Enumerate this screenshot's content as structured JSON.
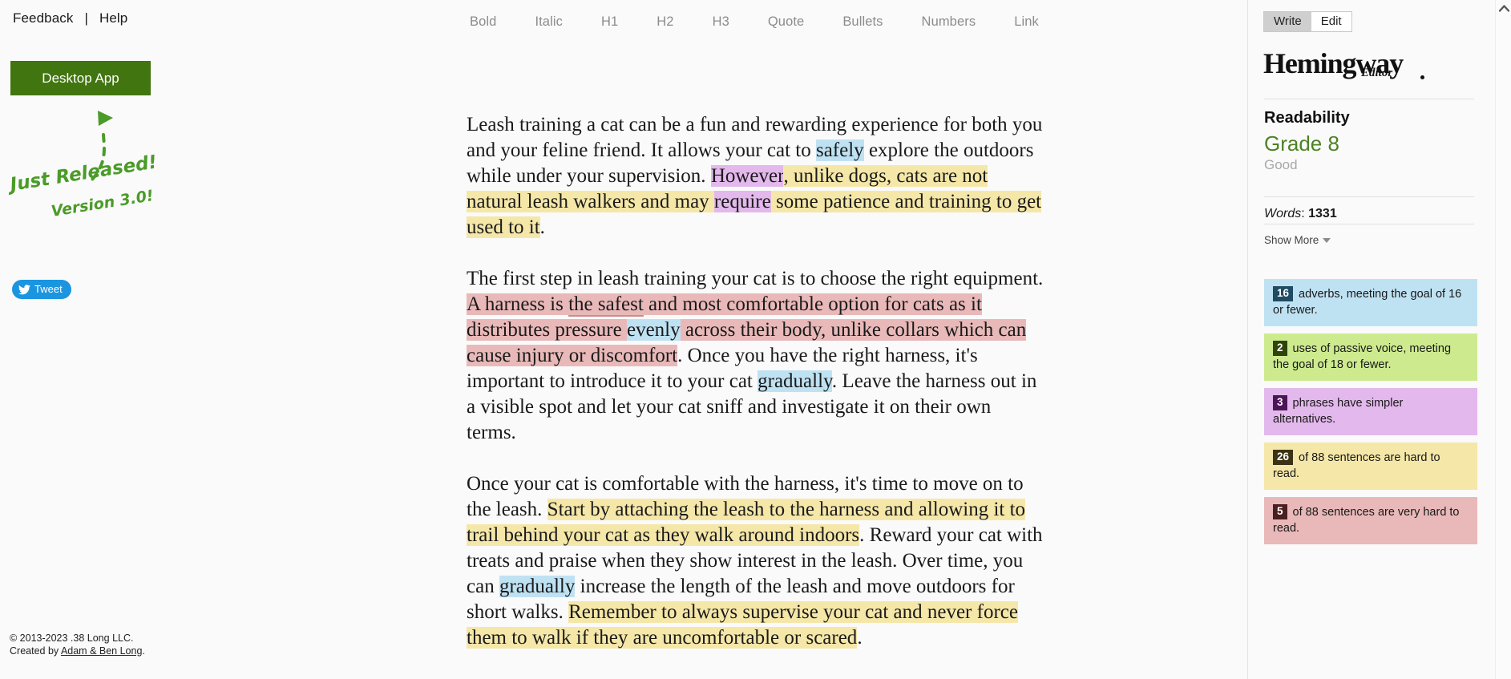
{
  "left": {
    "nav": {
      "feedback": "Feedback",
      "separator": "|",
      "help": "Help"
    },
    "desktop_app_button": "Desktop App",
    "promo": {
      "line1": "Just Released!",
      "line2": "Version 3.0!",
      "color": "#4b9b29"
    },
    "tweet_button": "Tweet",
    "footer": {
      "copyright": "© 2013-2023 .38 Long LLC.",
      "created_by_prefix": "Created by ",
      "created_by_link": "Adam & Ben Long",
      "created_by_suffix": "."
    }
  },
  "toolbar": {
    "items": [
      {
        "label": "Bold",
        "icon": "bold-icon"
      },
      {
        "label": "Italic",
        "icon": "italic-icon"
      },
      {
        "label": "H1",
        "icon": "heading1-icon"
      },
      {
        "label": "H2",
        "icon": "heading2-icon"
      },
      {
        "label": "H3",
        "icon": "heading3-icon"
      },
      {
        "label": "Quote",
        "icon": "quote-icon"
      },
      {
        "label": "Bullets",
        "icon": "bullets-icon"
      },
      {
        "label": "Numbers",
        "icon": "numbers-icon"
      },
      {
        "label": "Link",
        "icon": "link-icon"
      }
    ]
  },
  "editor": {
    "paragraphs": [
      {
        "id": "p1",
        "runs": [
          {
            "text": "Leash training a cat can be a fun and rewarding experience for both you and your feline friend. It allows your cat to ",
            "style": "none"
          },
          {
            "text": "safely",
            "style": "adverb"
          },
          {
            "text": " explore the outdoors while under your supervision. ",
            "style": "none"
          },
          {
            "text": "However",
            "style": "simpler"
          },
          {
            "text": ", unlike dogs, cats are not natural leash walkers and may ",
            "style": "hard"
          },
          {
            "text": "require",
            "style": "simpler"
          },
          {
            "text": " some patience and training to get used to it",
            "style": "hard"
          },
          {
            "text": ".",
            "style": "none"
          }
        ]
      },
      {
        "id": "p2",
        "runs": [
          {
            "text": "The first step in leash training your cat is to choose the right equipment. ",
            "style": "none"
          },
          {
            "text": "A harness is ",
            "style": "veryhard"
          },
          {
            "text": "the safest",
            "style": "veryhard-underline"
          },
          {
            "text": " and most comfortable option for cats as it distributes pressure ",
            "style": "veryhard"
          },
          {
            "text": "evenly",
            "style": "adverb"
          },
          {
            "text": " across their body, unlike collars which can cause injury or discomfort",
            "style": "veryhard"
          },
          {
            "text": ". Once you have the right harness, it's important to introduce it to your cat ",
            "style": "none"
          },
          {
            "text": "gradually",
            "style": "adverb"
          },
          {
            "text": ". Leave the harness out in a visible spot and let your cat sniff and investigate it on their own terms.",
            "style": "none"
          }
        ]
      },
      {
        "id": "p3",
        "runs": [
          {
            "text": "Once your cat is comfortable with the harness, it's time to move on to the leash. ",
            "style": "none"
          },
          {
            "text": "Start by attaching the leash to the harness and allowing it to trail behind your cat as they walk around indoors",
            "style": "hard"
          },
          {
            "text": ". Reward your cat with treats and praise when they show interest in the leash. Over time, you can ",
            "style": "none"
          },
          {
            "text": "gradually",
            "style": "adverb"
          },
          {
            "text": " increase the length of the leash and move outdoors for short walks. ",
            "style": "none"
          },
          {
            "text": "Remember to always supervise your cat and never force them to walk if they are uncomfortable or scared",
            "style": "hard"
          },
          {
            "text": ".",
            "style": "none"
          }
        ]
      }
    ]
  },
  "sidebar": {
    "mode_tabs": [
      {
        "label": "Write",
        "active": true
      },
      {
        "label": "Edit",
        "active": false
      }
    ],
    "brand": {
      "main": "Hemingway",
      "sub": "Editor"
    },
    "readability": {
      "title": "Readability",
      "grade": "Grade 8",
      "quality": "Good",
      "grade_color": "#4d8224"
    },
    "words": {
      "label": "Words",
      "separator": ": ",
      "value": "1331"
    },
    "show_more": {
      "label": "Show More",
      "icon": "chevron-down-icon"
    },
    "stats": [
      {
        "key": "adverbs",
        "count": "16",
        "text": " adverbs, meeting the goal of 16 or fewer.",
        "bg": "#bfe2f3",
        "badge_bg": "#1f4b63"
      },
      {
        "key": "passive-voice",
        "count": "2",
        "text": " uses of passive voice, meeting the goal of 18 or fewer.",
        "bg": "#cdeb8e",
        "badge_bg": "#2f4406"
      },
      {
        "key": "simpler-alternatives",
        "count": "3",
        "text": " phrases have simpler alternatives.",
        "bg": "#e3b8ec",
        "badge_bg": "#4e1459"
      },
      {
        "key": "hard-sentences",
        "count": "26",
        "text": " of 88 sentences are hard to read.",
        "bg": "#f5e7a8",
        "badge_bg": "#3b3314"
      },
      {
        "key": "very-hard-sentences",
        "count": "5",
        "text": " of 88 sentences are very hard to read.",
        "bg": "#e9b9b9",
        "badge_bg": "#4a1f1f"
      }
    ]
  },
  "scrollbar": {
    "up_icon": "chevron-up-icon"
  },
  "colors": {
    "accent_green": "#41750f",
    "twitter_blue": "#1b95e0",
    "page_bg": "#fafafa"
  }
}
